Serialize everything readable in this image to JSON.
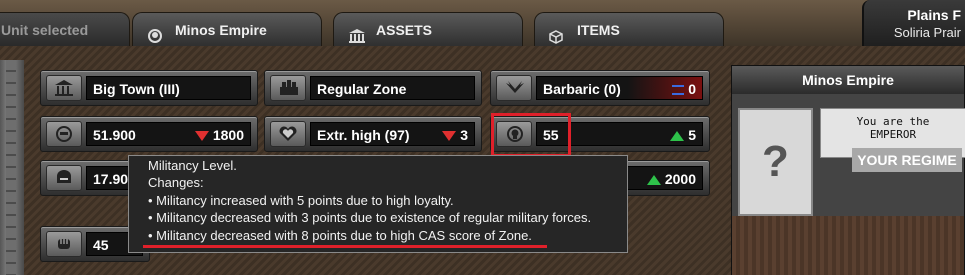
{
  "tabs": [
    {
      "label": "Unit selected",
      "icon": ""
    },
    {
      "label": "Minos Empire",
      "icon": "skull-wreath-icon"
    },
    {
      "label": "ASSETS",
      "icon": "building-icon"
    },
    {
      "label": "ITEMS",
      "icon": "cube-icon"
    }
  ],
  "location": {
    "line1": "Plains F",
    "line2": "Soliria Prair"
  },
  "stats": {
    "town": "Big Town (III)",
    "zone": "Regular Zone",
    "barbaric": {
      "label": "Barbaric (0)",
      "value": "0"
    },
    "population": {
      "value": "51.900",
      "delta": "1800"
    },
    "loyalty": {
      "label": "Extr. high (97)",
      "delta": "3"
    },
    "militancy": {
      "value": "55",
      "delta": "5"
    },
    "row3_left": {
      "value": "17.90"
    },
    "row3_right": {
      "delta": "2000"
    },
    "strength": {
      "value": "45"
    }
  },
  "panel": {
    "title": "Minos Empire",
    "question": "?",
    "emperor_line1": "You are the",
    "emperor_line2": "EMPEROR",
    "regime": "YOUR REGIME"
  },
  "tooltip": {
    "title": "Militancy Level.",
    "subtitle": "Changes:",
    "lines": [
      "• Militancy increased with 5 points due to high loyalty.",
      "• Militancy decreased with 3 points due to existence of regular military forces.",
      "• Militancy decreased with 8 points due to high CAS score of Zone."
    ]
  },
  "colors": {
    "highlight": "#e0202a",
    "up": "#2ec24a",
    "down": "#e03030"
  }
}
